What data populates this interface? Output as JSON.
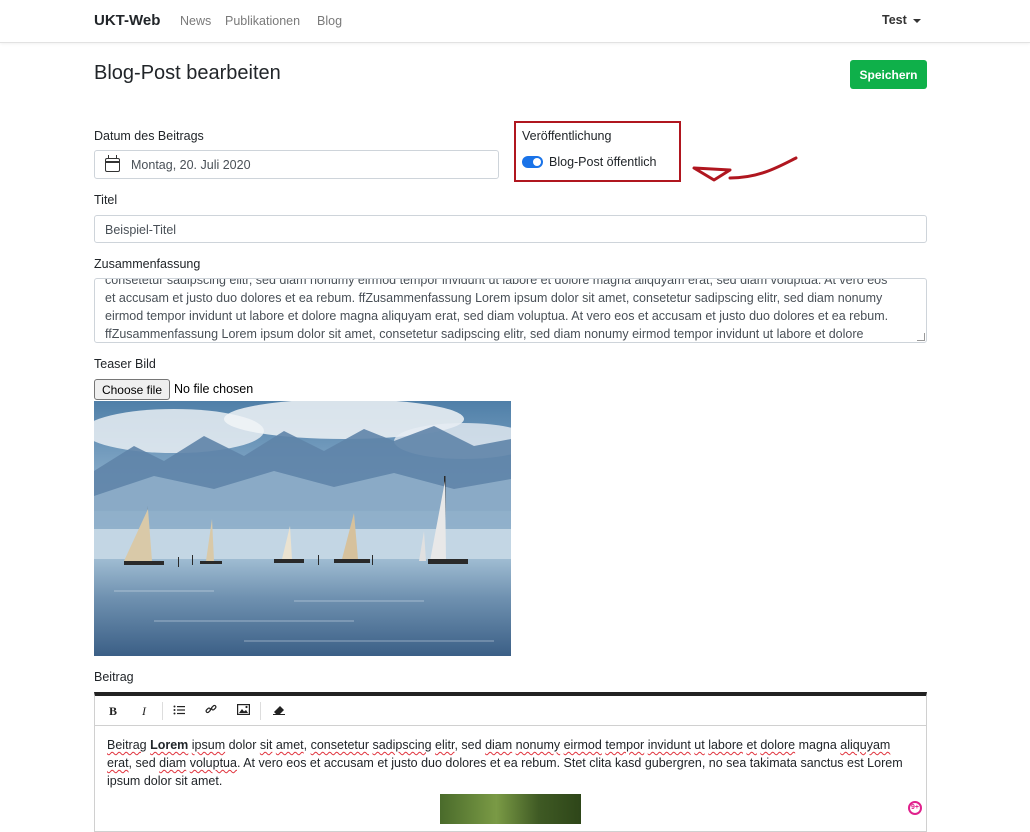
{
  "navbar": {
    "brand": "UKT-Web",
    "links": [
      "News",
      "Publikationen",
      "Blog"
    ],
    "user": "Test"
  },
  "page": {
    "title": "Blog-Post bearbeiten",
    "save_label": "Speichern"
  },
  "form": {
    "date_label": "Datum des Beitrags",
    "date_value": "Montag, 20. Juli 2020",
    "publish_label": "Veröffentlichung",
    "publish_toggle_label": "Blog-Post öffentlich",
    "publish_on": true,
    "title_label": "Titel",
    "title_value": "Beispiel-Titel",
    "summary_label": "Zusammenfassung",
    "summary_lines": [
      "consetetur sadipscing elitr, sed diam nonumy eirmod tempor invidunt ut labore et dolore magna aliquyam erat, sed diam voluptua. At vero eos",
      "et accusam et justo duo dolores et ea rebum. ffZusammenfassung Lorem ipsum dolor sit amet, consetetur sadipscing elitr, sed diam nonumy",
      "eirmod tempor invidunt ut labore et dolore magna aliquyam erat, sed diam voluptua. At vero eos et accusam et justo duo dolores et ea rebum.",
      "ffZusammenfassung Lorem ipsum dolor sit amet, consetetur sadipscing elitr, sed diam nonumy eirmod tempor invidunt ut labore et dolore"
    ],
    "teaser_label": "Teaser Bild",
    "file_button": "Choose file",
    "file_status": "No file chosen",
    "post_label": "Beitrag"
  },
  "editor": {
    "toolbar": [
      "bold-icon",
      "italic-icon",
      "list-icon",
      "link-icon",
      "image-icon",
      "eraser-icon"
    ],
    "counter": "9+"
  },
  "colors": {
    "accent_blue": "#1a73e8",
    "save_green": "#0fb04a",
    "highlight_red": "#b0161f"
  }
}
